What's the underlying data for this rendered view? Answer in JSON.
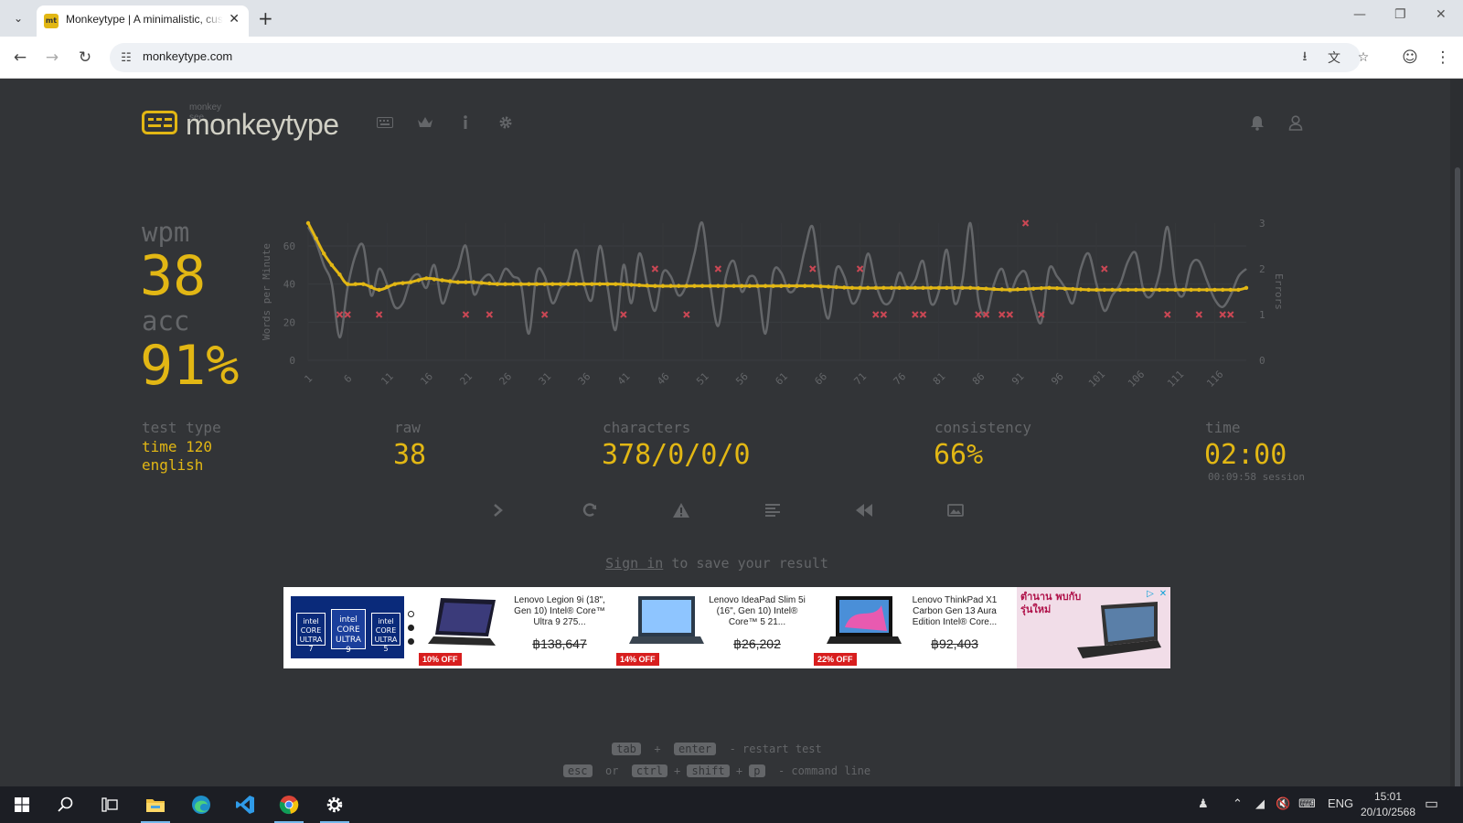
{
  "browser": {
    "tab_title": "Monkeytype | A minimalistic, customizable typing test",
    "favicon_text": "mt",
    "url": "monkeytype.com"
  },
  "header": {
    "logo_sub": "monkey see",
    "logo_text": "monkeytype",
    "icons": [
      "keyboard-icon",
      "crown-icon",
      "info-icon",
      "settings-icon",
      "bell-icon",
      "user-icon"
    ]
  },
  "result": {
    "wpm_label": "wpm",
    "wpm_value": "38",
    "acc_label": "acc",
    "acc_value": "91%",
    "test_type_label": "test type",
    "test_type_lines": [
      "time 120",
      "english"
    ],
    "raw_label": "raw",
    "raw_value": "38",
    "characters_label": "characters",
    "characters_value": "378/0/0/0",
    "consistency_label": "consistency",
    "consistency_value": "66%",
    "time_label": "time",
    "time_value": "02:00",
    "session_text": "00:09:58 session"
  },
  "chart_data": {
    "type": "line",
    "ylabel": "Words per Minute",
    "y2label": "Errors",
    "ylim": [
      0,
      72
    ],
    "y2lim": [
      0,
      3
    ],
    "yticks": [
      0,
      20,
      40,
      60
    ],
    "y2ticks": [
      0,
      1,
      2,
      3
    ],
    "xticks": [
      1,
      6,
      11,
      16,
      21,
      26,
      31,
      36,
      41,
      46,
      51,
      56,
      61,
      66,
      71,
      76,
      81,
      86,
      91,
      96,
      101,
      106,
      111,
      116
    ],
    "x_max": 120,
    "colors": {
      "wpm": "#e2b714",
      "raw": "#646669",
      "errors": "#ca4754"
    },
    "series": [
      {
        "name": "wpm",
        "x": [
          1,
          2,
          3,
          4,
          5,
          6,
          8,
          10,
          12,
          14,
          16,
          18,
          20,
          22,
          25,
          30,
          35,
          40,
          45,
          50,
          55,
          60,
          65,
          70,
          75,
          80,
          85,
          90,
          95,
          100,
          105,
          110,
          115,
          118,
          119,
          120
        ],
        "values": [
          72,
          64,
          56,
          50,
          45,
          40,
          40,
          37,
          40,
          41,
          43,
          42,
          41,
          41,
          40,
          40,
          40,
          40,
          39,
          39,
          39,
          39,
          39,
          38,
          38,
          38,
          38,
          37,
          38,
          37,
          37,
          37,
          37,
          37,
          37,
          38
        ]
      },
      {
        "name": "raw",
        "x": [
          1,
          2,
          3,
          4,
          5,
          6,
          7,
          8,
          9,
          10,
          11,
          12,
          13,
          14,
          15,
          16,
          17,
          18,
          19,
          20,
          21,
          22,
          23,
          24,
          25,
          26,
          27,
          28,
          29,
          30,
          31,
          32,
          33,
          34,
          35,
          36,
          37,
          38,
          39,
          40,
          41,
          42,
          43,
          44,
          45,
          46,
          47,
          48,
          49,
          50,
          51,
          52,
          53,
          54,
          55,
          56,
          57,
          58,
          59,
          60,
          61,
          62,
          63,
          64,
          65,
          66,
          67,
          68,
          69,
          70,
          71,
          72,
          73,
          74,
          75,
          76,
          77,
          78,
          79,
          80,
          81,
          82,
          83,
          84,
          85,
          86,
          87,
          88,
          89,
          90,
          91,
          92,
          93,
          94,
          95,
          96,
          97,
          98,
          99,
          100,
          101,
          102,
          103,
          104,
          105,
          106,
          107,
          108,
          109,
          110,
          111,
          112,
          113,
          114,
          115,
          116,
          117,
          118,
          119,
          120
        ],
        "values": [
          70,
          62,
          50,
          40,
          12,
          38,
          55,
          60,
          34,
          48,
          40,
          28,
          30,
          42,
          45,
          38,
          50,
          30,
          40,
          48,
          60,
          35,
          42,
          45,
          40,
          48,
          44,
          40,
          14,
          46,
          44,
          30,
          38,
          42,
          58,
          40,
          32,
          60,
          38,
          16,
          50,
          30,
          56,
          40,
          26,
          46,
          44,
          34,
          40,
          56,
          72,
          40,
          18,
          44,
          52,
          36,
          44,
          40,
          14,
          46,
          46,
          36,
          40,
          58,
          70,
          40,
          22,
          48,
          44,
          30,
          36,
          56,
          40,
          30,
          32,
          46,
          38,
          42,
          52,
          30,
          36,
          58,
          30,
          42,
          72,
          32,
          24,
          40,
          48,
          36,
          44,
          46,
          30,
          20,
          48,
          44,
          38,
          30,
          48,
          56,
          40,
          26,
          34,
          40,
          52,
          56,
          36,
          34,
          46,
          70,
          40,
          34,
          50,
          52,
          42,
          32,
          28,
          34,
          44,
          48
        ]
      },
      {
        "name": "errors",
        "x": [
          5,
          6,
          10,
          21,
          24,
          31,
          41,
          45,
          49,
          53,
          65,
          71,
          73,
          74,
          78,
          79,
          86,
          87,
          89,
          90,
          92,
          94,
          102,
          110,
          114,
          117,
          118
        ],
        "values": [
          1,
          1,
          1,
          1,
          1,
          1,
          1,
          2,
          1,
          2,
          2,
          2,
          1,
          1,
          1,
          1,
          1,
          1,
          1,
          1,
          3,
          1,
          2,
          1,
          1,
          1,
          1
        ]
      }
    ]
  },
  "actions": [
    "next-test",
    "restart",
    "report",
    "words-history",
    "replay",
    "screenshot"
  ],
  "signin": {
    "link": "Sign in",
    "rest": "to save your result"
  },
  "ad": {
    "products": [
      {
        "title": "Lenovo Legion 9i (18\", Gen 10) Intel® Core™ Ultra 9 275...",
        "price": "฿138,647",
        "discount": "10% OFF"
      },
      {
        "title": "Lenovo IdeaPad Slim 5i (16\", Gen 10) Intel® Core™ 5 21...",
        "price": "฿26,202",
        "discount": "14% OFF"
      },
      {
        "title": "Lenovo ThinkPad X1 Carbon Gen 13 Aura Edition Intel® Core...",
        "price": "฿92,403",
        "discount": "22% OFF"
      }
    ],
    "promo_text": "ตำนาน พบกับรุ่นใหม่",
    "intel_labels": [
      "intel CORE ULTRA 7",
      "intel CORE ULTRA 9",
      "intel CORE ULTRA 5"
    ]
  },
  "shortcuts": {
    "line1_keys": [
      "tab",
      "enter"
    ],
    "line1_text": "- restart test",
    "line2_keys": [
      "esc",
      "ctrl",
      "shift",
      "p"
    ],
    "line2_or": "or",
    "line2_text": "- command line"
  },
  "taskbar": {
    "lang": "ENG",
    "time": "15:01",
    "date": "20/10/2568"
  }
}
